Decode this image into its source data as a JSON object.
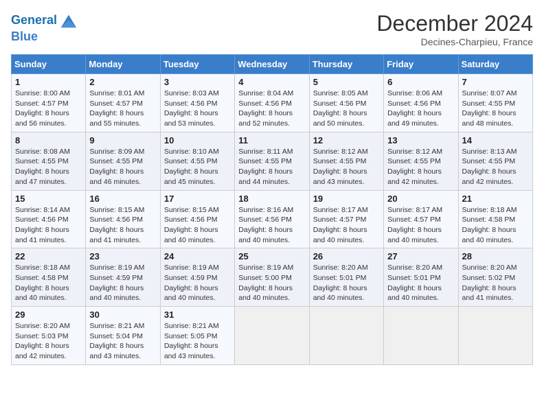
{
  "header": {
    "logo_line1": "General",
    "logo_line2": "Blue",
    "month": "December 2024",
    "location": "Decines-Charpieu, France"
  },
  "weekdays": [
    "Sunday",
    "Monday",
    "Tuesday",
    "Wednesday",
    "Thursday",
    "Friday",
    "Saturday"
  ],
  "weeks": [
    [
      {
        "day": "1",
        "sunrise": "8:00 AM",
        "sunset": "4:57 PM",
        "daylight": "8 hours and 56 minutes."
      },
      {
        "day": "2",
        "sunrise": "8:01 AM",
        "sunset": "4:57 PM",
        "daylight": "8 hours and 55 minutes."
      },
      {
        "day": "3",
        "sunrise": "8:03 AM",
        "sunset": "4:56 PM",
        "daylight": "8 hours and 53 minutes."
      },
      {
        "day": "4",
        "sunrise": "8:04 AM",
        "sunset": "4:56 PM",
        "daylight": "8 hours and 52 minutes."
      },
      {
        "day": "5",
        "sunrise": "8:05 AM",
        "sunset": "4:56 PM",
        "daylight": "8 hours and 50 minutes."
      },
      {
        "day": "6",
        "sunrise": "8:06 AM",
        "sunset": "4:56 PM",
        "daylight": "8 hours and 49 minutes."
      },
      {
        "day": "7",
        "sunrise": "8:07 AM",
        "sunset": "4:55 PM",
        "daylight": "8 hours and 48 minutes."
      }
    ],
    [
      {
        "day": "8",
        "sunrise": "8:08 AM",
        "sunset": "4:55 PM",
        "daylight": "8 hours and 47 minutes."
      },
      {
        "day": "9",
        "sunrise": "8:09 AM",
        "sunset": "4:55 PM",
        "daylight": "8 hours and 46 minutes."
      },
      {
        "day": "10",
        "sunrise": "8:10 AM",
        "sunset": "4:55 PM",
        "daylight": "8 hours and 45 minutes."
      },
      {
        "day": "11",
        "sunrise": "8:11 AM",
        "sunset": "4:55 PM",
        "daylight": "8 hours and 44 minutes."
      },
      {
        "day": "12",
        "sunrise": "8:12 AM",
        "sunset": "4:55 PM",
        "daylight": "8 hours and 43 minutes."
      },
      {
        "day": "13",
        "sunrise": "8:12 AM",
        "sunset": "4:55 PM",
        "daylight": "8 hours and 42 minutes."
      },
      {
        "day": "14",
        "sunrise": "8:13 AM",
        "sunset": "4:55 PM",
        "daylight": "8 hours and 42 minutes."
      }
    ],
    [
      {
        "day": "15",
        "sunrise": "8:14 AM",
        "sunset": "4:56 PM",
        "daylight": "8 hours and 41 minutes."
      },
      {
        "day": "16",
        "sunrise": "8:15 AM",
        "sunset": "4:56 PM",
        "daylight": "8 hours and 41 minutes."
      },
      {
        "day": "17",
        "sunrise": "8:15 AM",
        "sunset": "4:56 PM",
        "daylight": "8 hours and 40 minutes."
      },
      {
        "day": "18",
        "sunrise": "8:16 AM",
        "sunset": "4:56 PM",
        "daylight": "8 hours and 40 minutes."
      },
      {
        "day": "19",
        "sunrise": "8:17 AM",
        "sunset": "4:57 PM",
        "daylight": "8 hours and 40 minutes."
      },
      {
        "day": "20",
        "sunrise": "8:17 AM",
        "sunset": "4:57 PM",
        "daylight": "8 hours and 40 minutes."
      },
      {
        "day": "21",
        "sunrise": "8:18 AM",
        "sunset": "4:58 PM",
        "daylight": "8 hours and 40 minutes."
      }
    ],
    [
      {
        "day": "22",
        "sunrise": "8:18 AM",
        "sunset": "4:58 PM",
        "daylight": "8 hours and 40 minutes."
      },
      {
        "day": "23",
        "sunrise": "8:19 AM",
        "sunset": "4:59 PM",
        "daylight": "8 hours and 40 minutes."
      },
      {
        "day": "24",
        "sunrise": "8:19 AM",
        "sunset": "4:59 PM",
        "daylight": "8 hours and 40 minutes."
      },
      {
        "day": "25",
        "sunrise": "8:19 AM",
        "sunset": "5:00 PM",
        "daylight": "8 hours and 40 minutes."
      },
      {
        "day": "26",
        "sunrise": "8:20 AM",
        "sunset": "5:01 PM",
        "daylight": "8 hours and 40 minutes."
      },
      {
        "day": "27",
        "sunrise": "8:20 AM",
        "sunset": "5:01 PM",
        "daylight": "8 hours and 40 minutes."
      },
      {
        "day": "28",
        "sunrise": "8:20 AM",
        "sunset": "5:02 PM",
        "daylight": "8 hours and 41 minutes."
      }
    ],
    [
      {
        "day": "29",
        "sunrise": "8:20 AM",
        "sunset": "5:03 PM",
        "daylight": "8 hours and 42 minutes."
      },
      {
        "day": "30",
        "sunrise": "8:21 AM",
        "sunset": "5:04 PM",
        "daylight": "8 hours and 43 minutes."
      },
      {
        "day": "31",
        "sunrise": "8:21 AM",
        "sunset": "5:05 PM",
        "daylight": "8 hours and 43 minutes."
      },
      null,
      null,
      null,
      null
    ]
  ]
}
